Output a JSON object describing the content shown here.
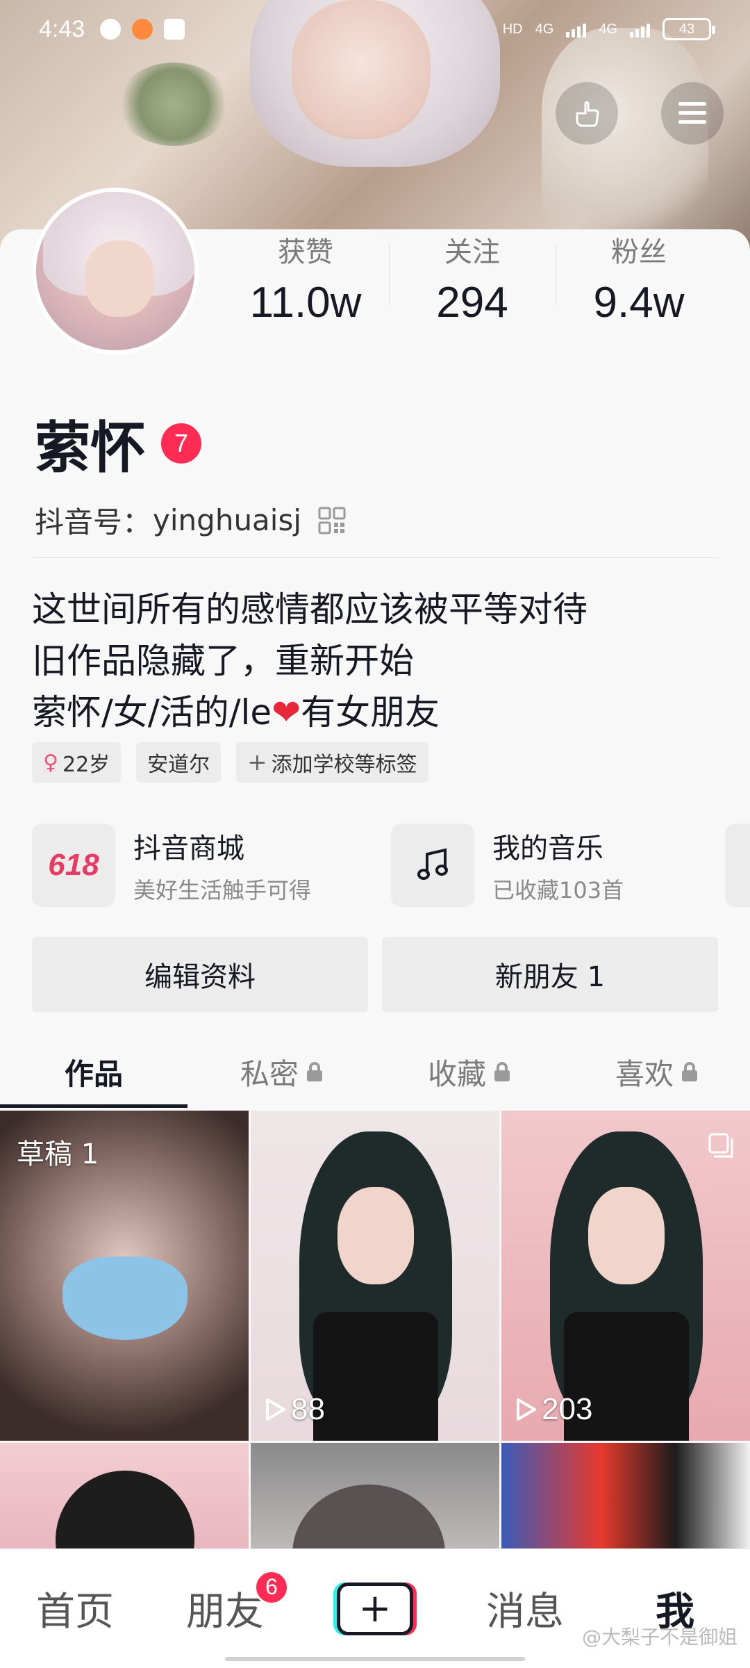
{
  "statusbar": {
    "time": "4:43",
    "network_left": "HD",
    "net1": "4G",
    "net2": "4G",
    "battery": "43"
  },
  "header": {
    "icons": [
      "notice-icon",
      "menu-icon"
    ]
  },
  "profile": {
    "stats": [
      {
        "label": "获赞",
        "value": "11.0w"
      },
      {
        "label": "关注",
        "value": "294"
      },
      {
        "label": "粉丝",
        "value": "9.4w"
      }
    ],
    "name": "萦怀",
    "name_badge": "7",
    "douyin_id_label": "抖音号：",
    "douyin_id": "yinghuaisj",
    "bio_lines": [
      "这世间所有的感情都应该被平等对待",
      "旧作品隐藏了，重新开始",
      "萦怀/女/活的/le"
    ],
    "bio_tail": "有女朋友",
    "heart": "❤",
    "tags": [
      {
        "label": "22岁",
        "icon": "female-icon"
      },
      {
        "label": "安道尔"
      },
      {
        "label": "添加学校等标签",
        "icon": "plus-icon"
      }
    ]
  },
  "shortcuts": [
    {
      "icon_text": "618",
      "title": "抖音商城",
      "subtitle": "美好生活触手可得"
    },
    {
      "icon": "music-note-icon",
      "title": "我的音乐",
      "subtitle": "已收藏103首"
    }
  ],
  "buttons": {
    "edit_profile": "编辑资料",
    "new_friends": "新朋友 1"
  },
  "tabs": [
    {
      "label": "作品",
      "active": true,
      "locked": false
    },
    {
      "label": "私密",
      "active": false,
      "locked": true
    },
    {
      "label": "收藏",
      "active": false,
      "locked": true
    },
    {
      "label": "喜欢",
      "active": false,
      "locked": true
    }
  ],
  "grid": [
    {
      "label": "草稿 1"
    },
    {
      "plays": "88"
    },
    {
      "plays": "203",
      "multi": true
    }
  ],
  "bottomnav": {
    "home": "首页",
    "friends": "朋友",
    "friends_badge": "6",
    "create": "+",
    "messages": "消息",
    "me": "我"
  },
  "watermark": "@大梨子不是御姐",
  "colors": {
    "accent": "#fe2c55",
    "text": "#161823",
    "muted": "#7a7a7a",
    "chip_bg": "#ececec"
  }
}
